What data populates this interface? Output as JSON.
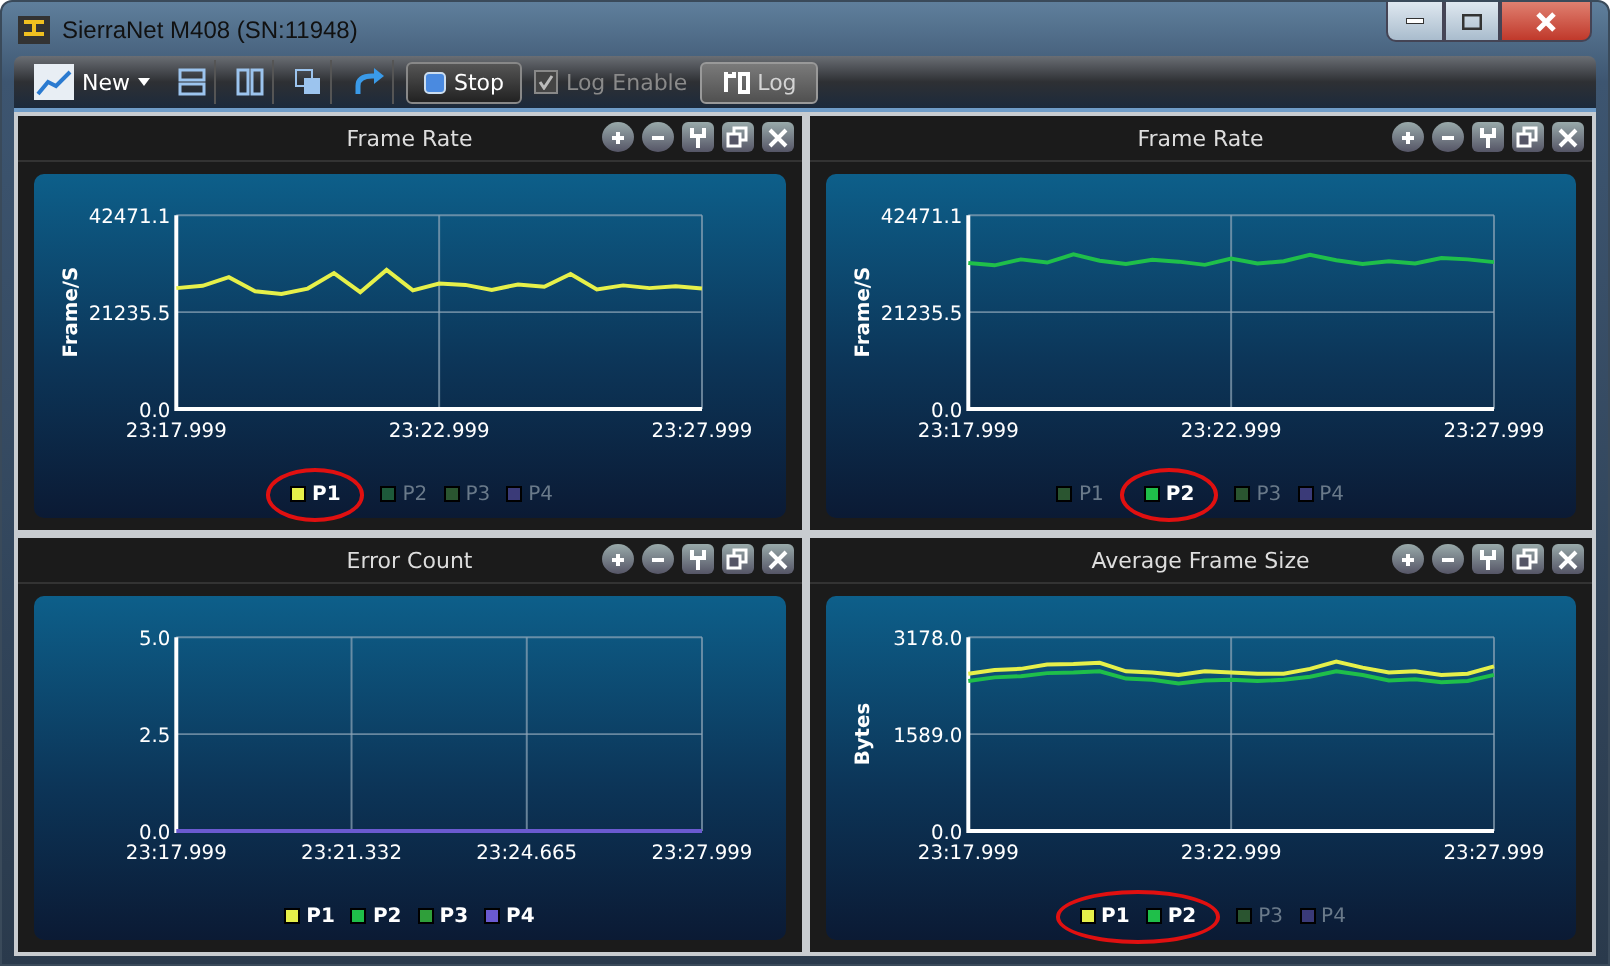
{
  "window": {
    "title": "SierraNet M408 (SN:11948)"
  },
  "toolbar": {
    "new_label": "New",
    "stop_label": "Stop",
    "log_enable": {
      "label": "Log Enable",
      "checked": true,
      "disabled": true
    },
    "log_button": {
      "label": "Log",
      "disabled": true
    }
  },
  "panels": [
    {
      "title": "Frame Rate",
      "legend_circled": true,
      "legend": [
        {
          "selected": true
        },
        {
          "selected": false
        },
        {
          "selected": false
        },
        {
          "selected": false
        }
      ],
      "chart_data": {
        "type": "line",
        "grid": true,
        "ylabel": "Frame/S",
        "categories": [
          "23:17.999",
          null,
          null,
          null,
          null,
          null,
          null,
          null,
          null,
          null,
          "23:22.999",
          null,
          null,
          null,
          null,
          null,
          null,
          null,
          null,
          null,
          "23:27.999"
        ],
        "ylim": [
          0,
          42471.1
        ],
        "yticks": [
          {
            "value": 0,
            "label": "0.0"
          },
          {
            "value": 21235.5,
            "label": "21235.5"
          },
          {
            "value": 42471.1,
            "label": "42471.1"
          }
        ],
        "series": [
          {
            "name": "P1",
            "color": "#e6f04a",
            "values": [
              26500,
              27000,
              28900,
              25800,
              25200,
              26400,
              29800,
              25600,
              30500,
              26000,
              27500,
              27200,
              26100,
              27300,
              26800,
              29600,
              26200,
              27100,
              26500,
              26900,
              26400
            ]
          },
          {
            "name": "P2",
            "color": "#1d5a3a",
            "values": [
              null,
              null,
              null,
              null,
              null,
              null,
              null,
              null,
              null,
              null,
              null,
              null,
              null,
              null,
              null,
              null,
              null,
              null,
              null,
              null,
              null
            ]
          },
          {
            "name": "P3",
            "color": "#2a5530",
            "values": [
              null,
              null,
              null,
              null,
              null,
              null,
              null,
              null,
              null,
              null,
              null,
              null,
              null,
              null,
              null,
              null,
              null,
              null,
              null,
              null,
              null
            ]
          },
          {
            "name": "P4",
            "color": "#3a3a78",
            "values": [
              null,
              null,
              null,
              null,
              null,
              null,
              null,
              null,
              null,
              null,
              null,
              null,
              null,
              null,
              null,
              null,
              null,
              null,
              null,
              null,
              null
            ]
          }
        ]
      }
    },
    {
      "title": "Frame Rate",
      "legend_circled": true,
      "legend": [
        {
          "selected": false
        },
        {
          "selected": true
        },
        {
          "selected": false
        },
        {
          "selected": false
        }
      ],
      "chart_data": {
        "type": "line",
        "grid": true,
        "ylabel": "Frame/S",
        "categories": [
          "23:17.999",
          null,
          null,
          null,
          null,
          null,
          null,
          null,
          null,
          null,
          "23:22.999",
          null,
          null,
          null,
          null,
          null,
          null,
          null,
          null,
          null,
          "23:27.999"
        ],
        "ylim": [
          0,
          42471.1
        ],
        "yticks": [
          {
            "value": 0,
            "label": "0.0"
          },
          {
            "value": 21235.5,
            "label": "21235.5"
          },
          {
            "value": 42471.1,
            "label": "42471.1"
          }
        ],
        "series": [
          {
            "name": "P1",
            "color": "#2a5530",
            "values": [
              null,
              null,
              null,
              null,
              null,
              null,
              null,
              null,
              null,
              null,
              null,
              null,
              null,
              null,
              null,
              null,
              null,
              null,
              null,
              null,
              null
            ]
          },
          {
            "name": "P2",
            "color": "#1fbf4a",
            "values": [
              32000,
              31500,
              32800,
              32100,
              33900,
              32500,
              31800,
              32700,
              32300,
              31600,
              33000,
              31900,
              32400,
              33800,
              32600,
              31800,
              32400,
              31900,
              33100,
              32800,
              32200
            ]
          },
          {
            "name": "P3",
            "color": "#2a5530",
            "values": [
              null,
              null,
              null,
              null,
              null,
              null,
              null,
              null,
              null,
              null,
              null,
              null,
              null,
              null,
              null,
              null,
              null,
              null,
              null,
              null,
              null
            ]
          },
          {
            "name": "P4",
            "color": "#3a3a78",
            "values": [
              null,
              null,
              null,
              null,
              null,
              null,
              null,
              null,
              null,
              null,
              null,
              null,
              null,
              null,
              null,
              null,
              null,
              null,
              null,
              null,
              null
            ]
          }
        ]
      }
    },
    {
      "title": "Error Count",
      "legend_circled": false,
      "legend": [
        {
          "selected": true
        },
        {
          "selected": true
        },
        {
          "selected": true
        },
        {
          "selected": true
        }
      ],
      "chart_data": {
        "type": "line",
        "grid": true,
        "categories": [
          "23:17.999",
          "23:21.332",
          "23:24.665",
          "23:27.999"
        ],
        "ylim": [
          0,
          5
        ],
        "yticks": [
          {
            "value": 0,
            "label": "0.0"
          },
          {
            "value": 2.5,
            "label": "2.5"
          },
          {
            "value": 5,
            "label": "5.0"
          }
        ],
        "series": [
          {
            "name": "P1",
            "color": "#e6f04a",
            "values": [
              null,
              null,
              null,
              null
            ]
          },
          {
            "name": "P2",
            "color": "#1fbf4a",
            "values": [
              null,
              null,
              null,
              null
            ]
          },
          {
            "name": "P3",
            "color": "#2f9f3a",
            "values": [
              null,
              null,
              null,
              null
            ]
          },
          {
            "name": "P4",
            "color": "#6a5ad0",
            "values": [
              0,
              0,
              0,
              0
            ]
          }
        ]
      }
    },
    {
      "title": "Average Frame Size",
      "legend_circled": true,
      "legend": [
        {
          "selected": true
        },
        {
          "selected": true
        },
        {
          "selected": false
        },
        {
          "selected": false
        }
      ],
      "chart_data": {
        "type": "line",
        "grid": true,
        "ylabel": "Bytes",
        "categories": [
          "23:17.999",
          null,
          null,
          null,
          null,
          null,
          null,
          null,
          null,
          null,
          "23:22.999",
          null,
          null,
          null,
          null,
          null,
          null,
          null,
          null,
          null,
          "23:27.999"
        ],
        "ylim": [
          0,
          3178
        ],
        "yticks": [
          {
            "value": 0,
            "label": "0.0"
          },
          {
            "value": 1589,
            "label": "1589.0"
          },
          {
            "value": 3178,
            "label": "3178.0"
          }
        ],
        "series": [
          {
            "name": "P1",
            "color": "#e6f04a",
            "values": [
              2580,
              2640,
              2660,
              2730,
              2740,
              2760,
              2620,
              2600,
              2560,
              2620,
              2600,
              2580,
              2580,
              2660,
              2780,
              2680,
              2600,
              2620,
              2560,
              2580,
              2700
            ]
          },
          {
            "name": "P2",
            "color": "#1fbf4a",
            "values": [
              2460,
              2520,
              2540,
              2590,
              2600,
              2620,
              2500,
              2480,
              2420,
              2470,
              2480,
              2460,
              2480,
              2530,
              2620,
              2560,
              2470,
              2490,
              2440,
              2460,
              2560
            ]
          },
          {
            "name": "P3",
            "color": "#2a5530",
            "values": [
              null,
              null,
              null,
              null,
              null,
              null,
              null,
              null,
              null,
              null,
              null,
              null,
              null,
              null,
              null,
              null,
              null,
              null,
              null,
              null,
              null
            ]
          },
          {
            "name": "P4",
            "color": "#3a3a78",
            "values": [
              null,
              null,
              null,
              null,
              null,
              null,
              null,
              null,
              null,
              null,
              null,
              null,
              null,
              null,
              null,
              null,
              null,
              null,
              null,
              null,
              null
            ]
          }
        ]
      }
    }
  ]
}
